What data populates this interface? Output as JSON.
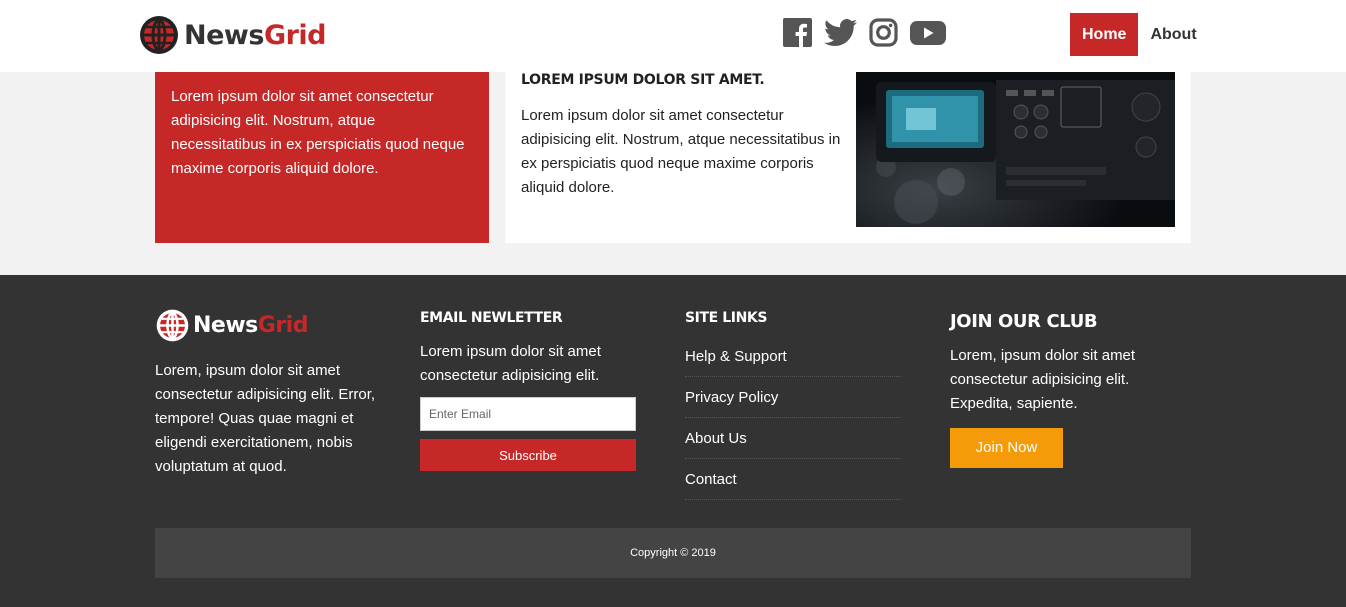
{
  "brand": {
    "name_part1": "News",
    "name_part2": "Grid"
  },
  "header": {
    "social": [
      "facebook-icon",
      "twitter-icon",
      "instagram-icon",
      "youtube-icon"
    ],
    "nav": [
      {
        "label": "Home",
        "active": true
      },
      {
        "label": "About",
        "active": false
      }
    ]
  },
  "showcase": {
    "red_text": "Lorem ipsum dolor sit amet consectetur adipisicing elit. Nostrum, atque necessitatibus in ex perspiciatis quod neque maxime corporis aliquid dolore.",
    "article_title": "Lorem ipsum dolor sit amet.",
    "article_text": "Lorem ipsum dolor sit amet consectetur adipisicing elit. Nostrum, atque necessitatibus in ex perspiciatis quod neque maxime corporis aliquid dolore."
  },
  "footer": {
    "about_text": "Lorem, ipsum dolor sit amet consectetur adipisicing elit. Error, tempore! Quas quae magni et eligendi exercitationem, nobis voluptatum at quod.",
    "newsletter": {
      "heading": "Email Newletter",
      "text": "Lorem ipsum dolor sit amet consectetur adipisicing elit.",
      "placeholder": "Enter Email",
      "button": "Subscribe"
    },
    "site_links": {
      "heading": "Site Links",
      "items": [
        "Help & Support",
        "Privacy Policy",
        "About Us",
        "Contact"
      ]
    },
    "club": {
      "heading": "Join Our Club",
      "text": "Lorem, ipsum dolor sit amet consectetur adipisicing elit. Expedita, sapiente.",
      "button": "Join Now"
    },
    "copyright": "Copyright © 2019"
  },
  "colors": {
    "primary": "#c62828",
    "dark": "#333333",
    "accent": "#f59a09",
    "light": "#f2f2f2"
  }
}
